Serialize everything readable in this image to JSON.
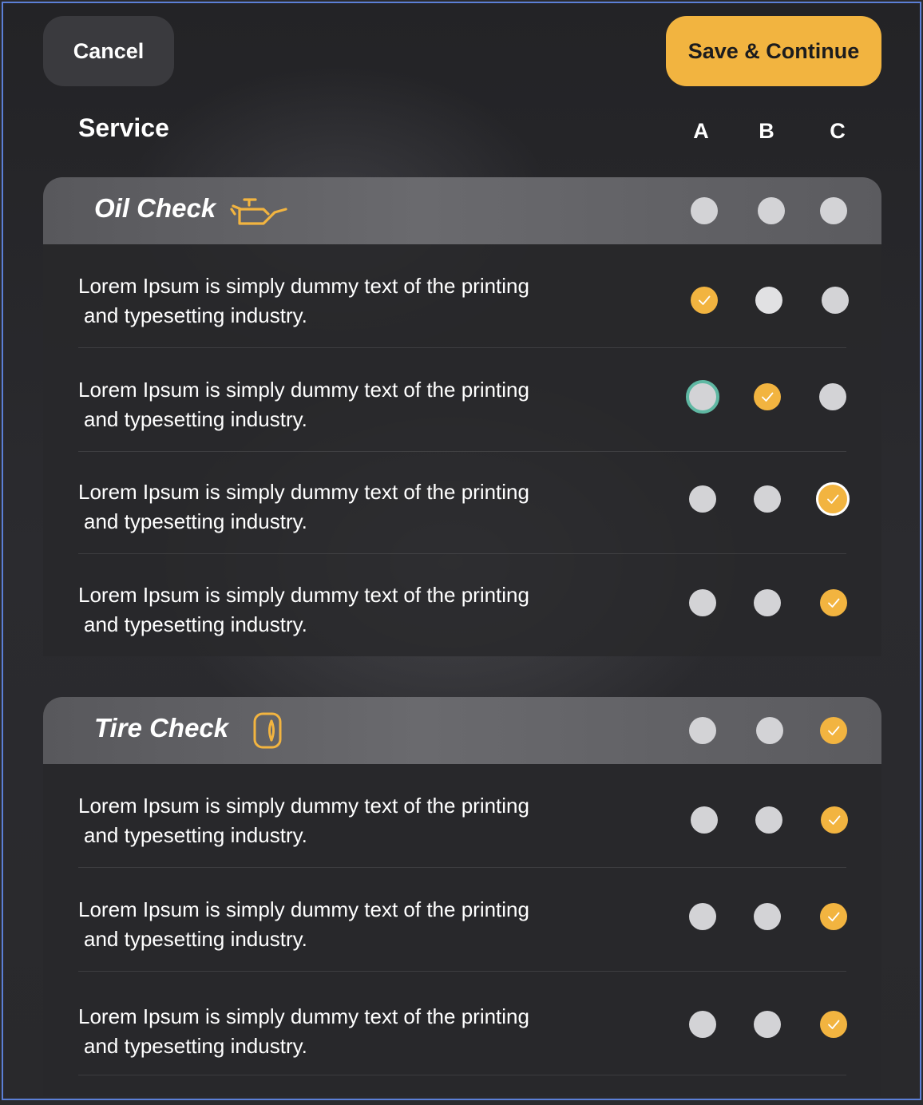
{
  "header": {
    "cancel_label": "Cancel",
    "save_label": "Save & Continue"
  },
  "service_title": "Service",
  "columns": [
    "A",
    "B",
    "C"
  ],
  "colors": {
    "accent": "#f2b440",
    "dot_unselected": "#d3d3d6",
    "focus_ring": "#5fb8a3"
  },
  "sections": [
    {
      "title": "Oil Check",
      "icon": "oil-can-icon",
      "header_selection": null,
      "rows": [
        {
          "line1": "Lorem Ipsum is simply dummy text of the printing",
          "line2": "and typesetting industry.",
          "selected": "A"
        },
        {
          "line1": "Lorem Ipsum is simply dummy text of the printing",
          "line2": "and typesetting industry.",
          "selected": "B",
          "focus": "A"
        },
        {
          "line1": "Lorem Ipsum is simply dummy text of the printing",
          "line2": "and typesetting industry.",
          "selected": "C",
          "focus": "C"
        },
        {
          "line1": "Lorem Ipsum is simply dummy text of the printing",
          "line2": "and typesetting industry.",
          "selected": "C"
        }
      ]
    },
    {
      "title": "Tire Check",
      "icon": "tire-icon",
      "header_selection": "C",
      "rows": [
        {
          "line1": "Lorem Ipsum is simply dummy text of the printing",
          "line2": "and typesetting industry.",
          "selected": "C"
        },
        {
          "line1": "Lorem Ipsum is simply dummy text of the printing",
          "line2": "and typesetting industry.",
          "selected": "C"
        },
        {
          "line1": "Lorem Ipsum is simply dummy text of the printing",
          "line2": "and typesetting industry.",
          "selected": "C"
        }
      ]
    }
  ]
}
